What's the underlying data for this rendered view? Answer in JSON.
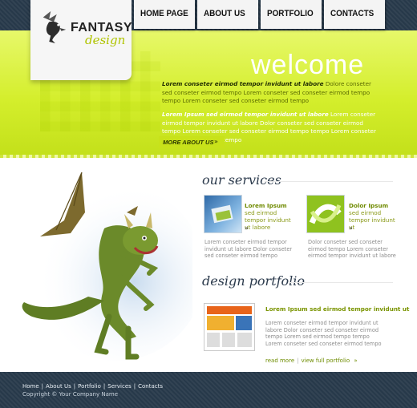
{
  "logo": {
    "line1": "FANTASY",
    "line2": "design"
  },
  "nav": {
    "items": [
      "HOME PAGE",
      "ABOUT US",
      "PORTFOLIO",
      "CONTACTS"
    ]
  },
  "hero": {
    "title": "welcome",
    "p1_bold": "Lorem conseter eirmod tempor invidunt ut labore",
    "p1_rest": " Dolore conseter sed conseter eirmod tempo Lorem conseter sed conseter eirmod tempo tempo Lorem conseter sed conseter eirmod tempo",
    "p2_bold": "Lorem Ipsum sed eirmod tempor invidunt ut labore",
    "p2_rest": " Lorem conseter eirmod tempor invidunt ut labore Dolor conseter sed conseter eirmod tempo Lorem conseter sed conseter eirmod tempo tempo Lorem conseter sed conseter eirmod tempo",
    "more_label": "MORE ABOUT US",
    "more_arrow": "»"
  },
  "services": {
    "title": "our services",
    "items": [
      {
        "head_bold": "Lorem Ipsum",
        "head_rest": " sed eirmod tempor invidunt ut labore",
        "arrow": "»",
        "text": "Lorem conseter eirmod tempor invidunt ut labore Dolor conseter sed conseter eirmod tempo"
      },
      {
        "head_bold": "Dolor Ipsum",
        "head_rest": " sed eirmod tempor invidunt ut",
        "arrow": "»",
        "text": "Dolor conseter sed conseter eirmod tempo Lorem conseter eirmod tempor invidunt ut labore"
      }
    ]
  },
  "portfolio": {
    "title": "design portfolio",
    "head": "Lorem Ipsum sed eirmod tempor invidunt ut",
    "text": "Lorem conseter eirmod tempor invidunt ut labore Dolor conseter sed conseter eirmod tempo Lorem sed eirmod tempo tempo Lorem conseter sed conseter eirmod tempo",
    "read_more": "read more",
    "sep": "|",
    "view_full": "view full portfolio",
    "arrow": "»"
  },
  "footer": {
    "links": [
      "Home",
      "About Us",
      "Portfolio",
      "Services",
      "Contacts"
    ],
    "sep": "|",
    "copyright": "Copyright © Your Company Name"
  },
  "colors": {
    "lime": "#d4ee2c",
    "navy": "#27394a",
    "olive": "#6f8a00"
  }
}
